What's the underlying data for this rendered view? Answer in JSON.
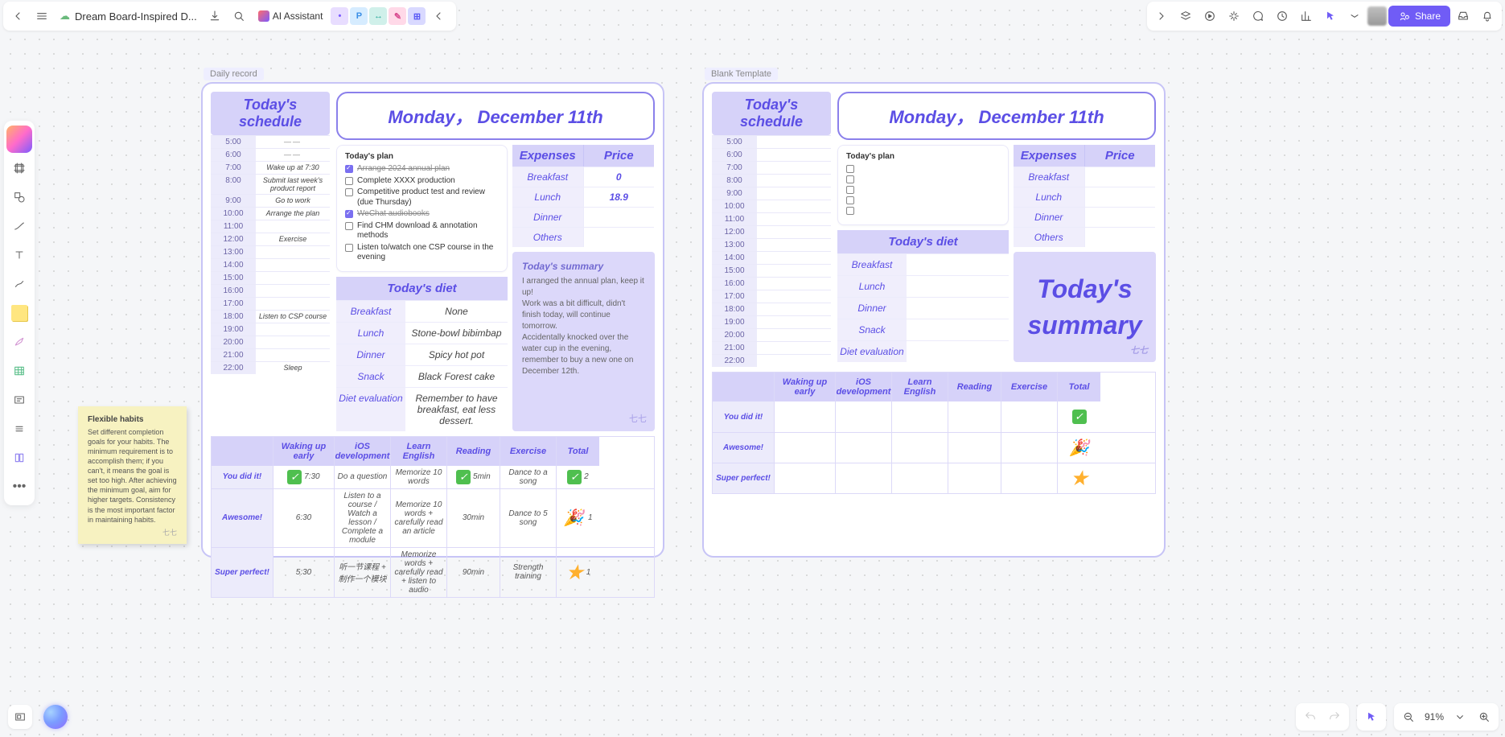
{
  "doc_title": "Dream Board-Inspired D...",
  "ai_label": "AI Assistant",
  "share_label": "Share",
  "avatar_chips": [
    "•",
    "P",
    "↔",
    "✎",
    "⊞"
  ],
  "zoom": "91%",
  "frame_labels": {
    "left": "Daily record",
    "right": "Blank Template"
  },
  "sticky": {
    "title": "Flexible habits",
    "body": "Set different completion goals for your habits. The minimum requirement is to accomplish them; if you can't, it means the goal is set too high. After achieving the minimum goal, aim for higher targets. Consistency is the most important factor in maintaining habits.",
    "sig": "七七"
  },
  "left": {
    "schedule_title": "Today's schedule",
    "date": "Monday， December 11th",
    "schedule": [
      {
        "time": "5:00",
        "task": "——"
      },
      {
        "time": "6:00",
        "task": "——"
      },
      {
        "time": "7:00",
        "task": "Wake up at 7:30"
      },
      {
        "time": "8:00",
        "task": "Submit last week's product report"
      },
      {
        "time": "9:00",
        "task": "Go to work"
      },
      {
        "time": "10:00",
        "task": "Arrange the plan"
      },
      {
        "time": "11:00",
        "task": ""
      },
      {
        "time": "12:00",
        "task": "Exercise"
      },
      {
        "time": "13:00",
        "task": ""
      },
      {
        "time": "14:00",
        "task": ""
      },
      {
        "time": "15:00",
        "task": ""
      },
      {
        "time": "16:00",
        "task": ""
      },
      {
        "time": "17:00",
        "task": ""
      },
      {
        "time": "18:00",
        "task": "Listen to CSP course"
      },
      {
        "time": "19:00",
        "task": ""
      },
      {
        "time": "20:00",
        "task": ""
      },
      {
        "time": "21:00",
        "task": ""
      },
      {
        "time": "22:00",
        "task": "Sleep"
      }
    ],
    "plan_title": "Today's plan",
    "plan": [
      {
        "done": true,
        "text": "Arrange 2024 annual plan"
      },
      {
        "done": false,
        "text": "Complete XXXX production"
      },
      {
        "done": false,
        "text": "Competitive product test and review (due Thursday)"
      },
      {
        "done": true,
        "text": "WeChat audiobooks"
      },
      {
        "done": false,
        "text": "Find CHM download & annotation methods"
      },
      {
        "done": false,
        "text": "Listen to/watch one CSP course in the evening"
      }
    ],
    "expenses": {
      "head": [
        "Expenses",
        "Price"
      ],
      "rows": [
        [
          "Breakfast",
          "0"
        ],
        [
          "Lunch",
          "18.9"
        ],
        [
          "Dinner",
          ""
        ],
        [
          "Others",
          ""
        ]
      ]
    },
    "summary": {
      "title": "Today's summary",
      "body": "I arranged the annual plan, keep it up!\nWork was a bit difficult, didn't finish today, will continue tomorrow.\nAccidentally knocked over the water cup in the evening, remember to buy a new one on December 12th.",
      "sig": "七七"
    },
    "diet": {
      "title": "Today's diet",
      "rows": [
        [
          "Breakfast",
          "None"
        ],
        [
          "Lunch",
          "Stone-bowl bibimbap"
        ],
        [
          "Dinner",
          "Spicy hot pot"
        ],
        [
          "Snack",
          "Black Forest cake"
        ],
        [
          "Diet evaluation",
          "Remember to have breakfast, eat less dessert."
        ]
      ]
    },
    "habits": {
      "cols": [
        "",
        "Waking up early",
        "iOS development",
        "Learn English",
        "Reading",
        "Exercise",
        "Total"
      ],
      "rows": [
        {
          "label": "You did it!",
          "cells": [
            "✅ 7:30",
            "Do a question",
            "Memorize 10 words",
            "✅ 5min",
            "Dance to a song",
            "✅ 2"
          ]
        },
        {
          "label": "Awesome!",
          "cells": [
            "6:30",
            "Listen to a course / Watch a lesson / Complete a module",
            "Memorize 10 words + carefully read an article",
            "30min",
            "Dance to 5 song",
            "🎉 1"
          ]
        },
        {
          "label": "Super perfect!",
          "cells": [
            "5:30",
            "听一节课程 + 制作一个模块",
            "Memorize words + carefully read + listen to audio",
            "90min",
            "Strength training",
            "⭐ 1"
          ]
        }
      ]
    }
  },
  "right": {
    "schedule_title": "Today's schedule",
    "date": "Monday， December 11th",
    "schedule_times": [
      "5:00",
      "6:00",
      "7:00",
      "8:00",
      "9:00",
      "10:00",
      "11:00",
      "12:00",
      "13:00",
      "14:00",
      "15:00",
      "16:00",
      "17:00",
      "18:00",
      "19:00",
      "20:00",
      "21:00",
      "22:00"
    ],
    "plan_title": "Today's plan",
    "expenses": {
      "head": [
        "Expenses",
        "Price"
      ],
      "rows": [
        [
          "Breakfast",
          ""
        ],
        [
          "Lunch",
          ""
        ],
        [
          "Dinner",
          ""
        ],
        [
          "Others",
          ""
        ]
      ]
    },
    "summary_title": "Today's summary",
    "diet": {
      "title": "Today's diet",
      "rows": [
        [
          "Breakfast",
          ""
        ],
        [
          "Lunch",
          ""
        ],
        [
          "Dinner",
          ""
        ],
        [
          "Snack",
          ""
        ],
        [
          "Diet evaluation",
          ""
        ]
      ]
    },
    "habits": {
      "cols": [
        "",
        "Waking up early",
        "iOS development",
        "Learn English",
        "Reading",
        "Exercise",
        "Total"
      ],
      "rows": [
        {
          "label": "You did it!",
          "total": "✅"
        },
        {
          "label": "Awesome!",
          "total": "🎉"
        },
        {
          "label": "Super perfect!",
          "total": "⭐"
        }
      ]
    }
  }
}
